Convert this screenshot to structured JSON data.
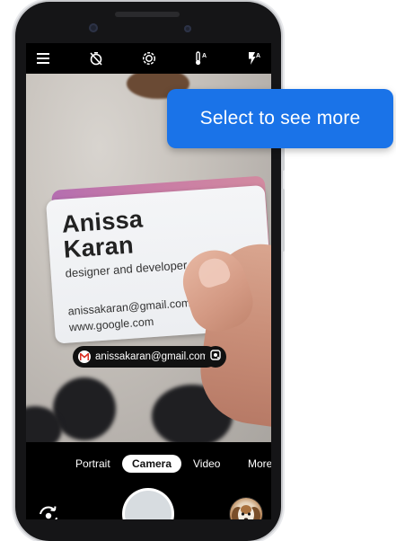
{
  "tooltip": {
    "text": "Select to see more"
  },
  "topbar": {
    "icons": [
      "menu-icon",
      "timer-off-icon",
      "motion-photo-icon",
      "white-balance-icon",
      "flash-auto-icon"
    ]
  },
  "card": {
    "name_line1": "Anissa",
    "name_line2": "Karan",
    "role": "designer and developer",
    "email": "anissakaran@gmail.com",
    "website": "www.google.com"
  },
  "lens": {
    "suggestion_text": "anissakaran@gmail.com"
  },
  "modes": {
    "portrait": "Portrait",
    "camera": "Camera",
    "video": "Video",
    "more": "More",
    "active": "Camera"
  },
  "colors": {
    "tooltip_bg": "#1a73e8",
    "phone_body": "#151517",
    "screen_bg": "#000000",
    "mode_active_bg": "#ffffff"
  }
}
